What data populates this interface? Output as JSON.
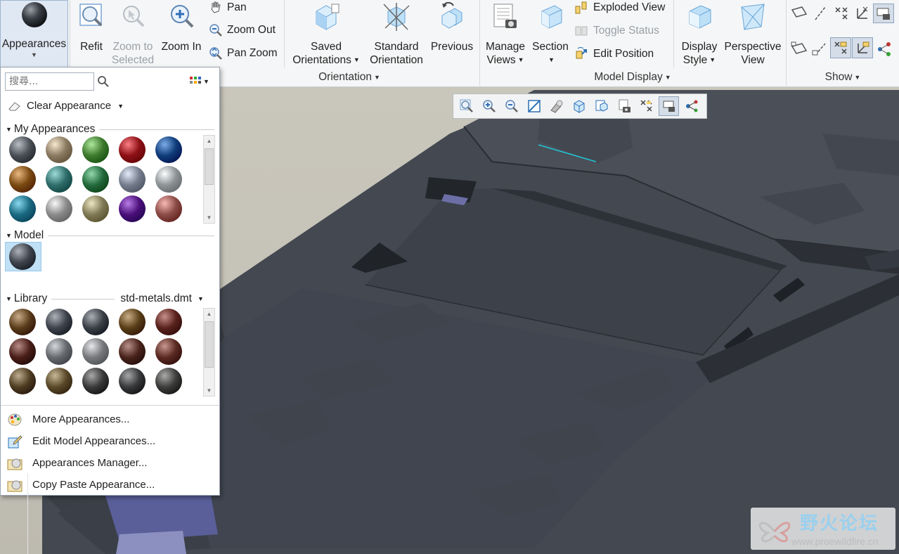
{
  "ribbon": {
    "appearances": "Appearances",
    "refit": "Refit",
    "zoom_to_selected_1": "Zoom to",
    "zoom_to_selected_2": "Selected",
    "zoom_in": "Zoom In",
    "pan": "Pan",
    "zoom_out": "Zoom Out",
    "pan_zoom": "Pan Zoom",
    "saved_orientations_1": "Saved",
    "saved_orientations_2": "Orientations",
    "standard_orientation_1": "Standard",
    "standard_orientation_2": "Orientation",
    "previous": "Previous",
    "manage_views_1": "Manage",
    "manage_views_2": "Views",
    "section": "Section",
    "exploded_view": "Exploded View",
    "toggle_status": "Toggle Status",
    "edit_position": "Edit Position",
    "display_style_1": "Display",
    "display_style_2": "Style",
    "perspective_view_1": "Perspective",
    "perspective_view_2": "View",
    "groups": {
      "orientation": "Orientation",
      "model_display": "Model Display",
      "show": "Show"
    }
  },
  "panel": {
    "search_placeholder": "搜尋...",
    "clear_appearance": "Clear Appearance",
    "my_appearances": "My Appearances",
    "model": "Model",
    "library": "Library",
    "library_file": "std-metals.dmt",
    "my_colors": [
      "#4b5057",
      "#8a7a62",
      "#3f7a2e",
      "#8c1016",
      "#0f3d7a",
      "#7a4a12",
      "#2f6d6a",
      "#236a3d",
      "#757d8c",
      "#8e9396",
      "#1a6a82",
      "#8a8a8a",
      "#7f7a55",
      "#4b0f7a",
      "#8a4a45"
    ],
    "model_colors": [
      "#3f444c"
    ],
    "library_colors": [
      "#5a3d1a",
      "#3f444c",
      "#3c4148",
      "#5a3f18",
      "#5a221c",
      "#4a1e18",
      "#66696e",
      "#77797d",
      "#4a241c",
      "#5a2a22",
      "#4f3e22",
      "#5a4a2a",
      "#3a3a3a",
      "#38393b",
      "#3d3d3b"
    ],
    "menu": [
      "More Appearances...",
      "Edit Model Appearances...",
      "Appearances Manager...",
      "Copy Paste Appearance..."
    ]
  },
  "watermark": {
    "title": "野火论坛",
    "url": "www.proewildfire.cn"
  },
  "colors": {
    "model": "#434851",
    "model_dark": "#2e3239",
    "background": "#c6c3b8",
    "highlight": "#22c4d4"
  }
}
